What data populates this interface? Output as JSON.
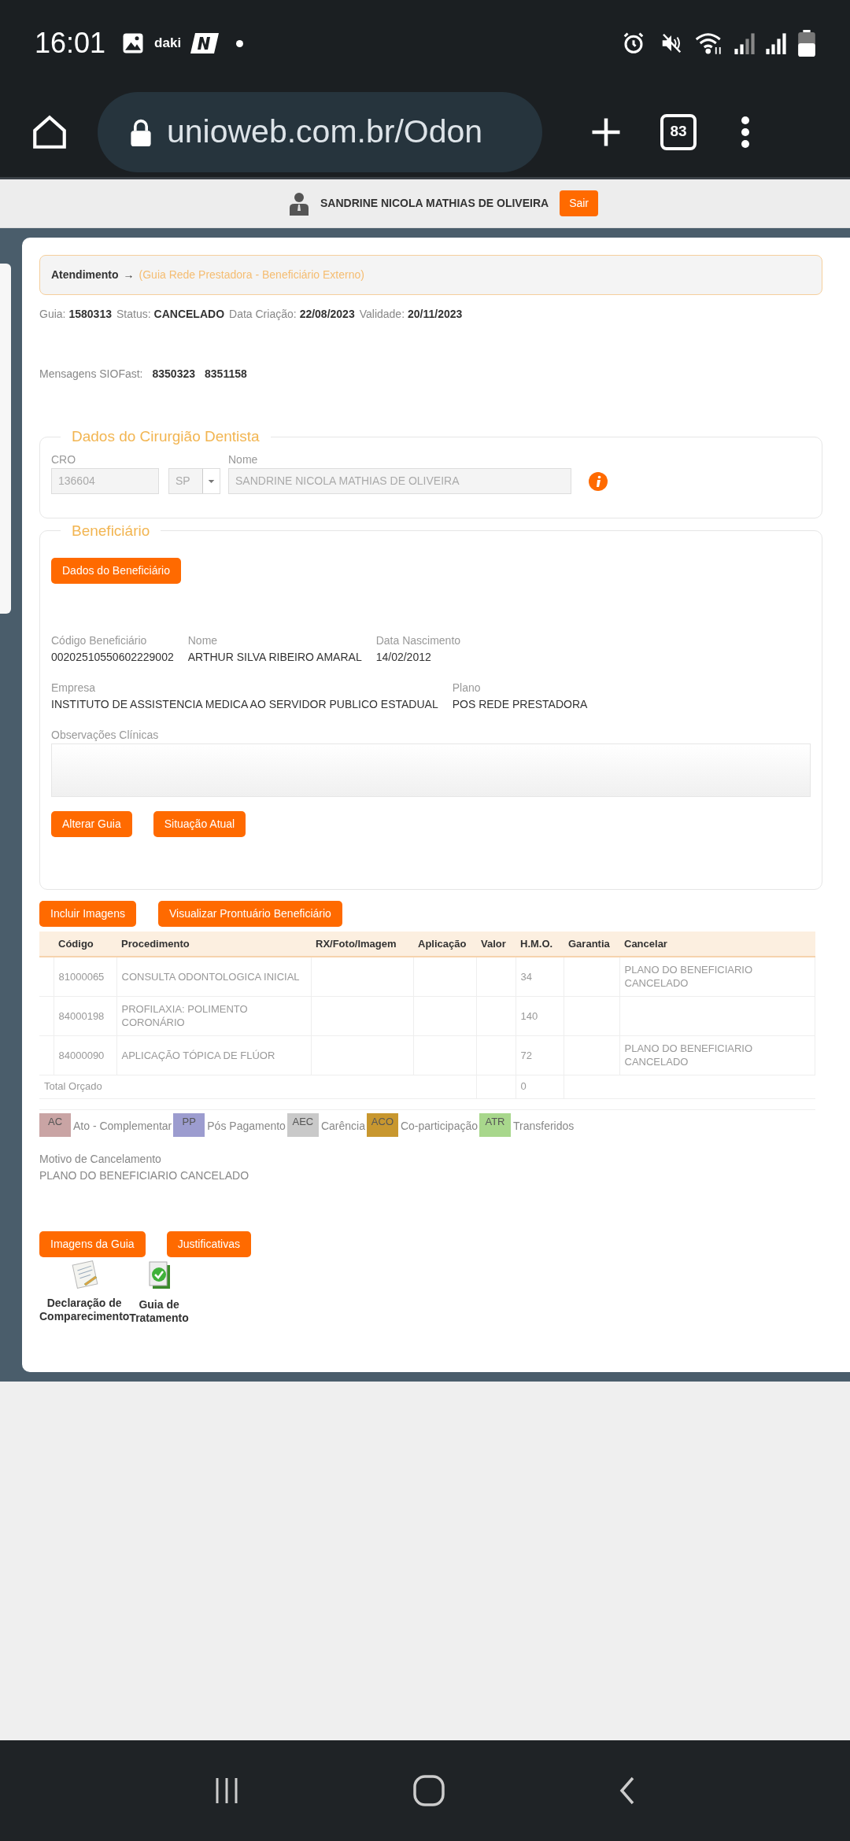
{
  "status_bar": {
    "time": "16:01",
    "app_label": "daki"
  },
  "browser": {
    "url": "unioweb.com.br/Odon",
    "tab_count": "83"
  },
  "header": {
    "user_name": "SANDRINE NICOLA MATHIAS DE OLIVEIRA",
    "logout_button": "Sair"
  },
  "breadcrumb": {
    "title": "Atendimento",
    "arrow": "→",
    "subtitle": "(Guia Rede Prestadora - Beneficiário Externo)"
  },
  "guide_info": [
    {
      "label": "Guia:",
      "value": "1580313"
    },
    {
      "label": "Status:",
      "value": "CANCELADO"
    },
    {
      "label": "Data Criação:",
      "value": "22/08/2023"
    },
    {
      "label": "Validade:",
      "value": "20/11/2023"
    }
  ],
  "messages": {
    "label": "Mensagens SIOFast:",
    "values": [
      "8350323",
      "8351158"
    ]
  },
  "dentist": {
    "legend": "Dados do Cirurgião Dentista",
    "disabled": true,
    "cro_label": "CRO",
    "cro": "136604",
    "uf": "SP",
    "name_label": "Nome",
    "name": "SANDRINE NICOLA MATHIAS DE OLIVEIRA"
  },
  "beneficiary": {
    "legend": "Beneficiário",
    "details_button": "Dados do Beneficiário",
    "fields_row1": [
      {
        "label": "Código Beneficiário",
        "value": "00202510550602229002"
      },
      {
        "label": "Nome",
        "value": "ARTHUR SILVA RIBEIRO AMARAL"
      },
      {
        "label": "Data Nascimento",
        "value": "14/02/2012"
      }
    ],
    "fields_row2": [
      {
        "label": "Empresa",
        "value": "INSTITUTO DE ASSISTENCIA MEDICA AO SERVIDOR PUBLICO ESTADUAL"
      },
      {
        "label": "Plano",
        "value": "POS REDE PRESTADORA"
      }
    ],
    "notes_label": "Observações Clínicas",
    "buttons": [
      "Alterar Guia",
      "Situação Atual"
    ]
  },
  "action_buttons": [
    "Incluir Imagens",
    "Visualizar Prontuário Beneficiário"
  ],
  "table": {
    "columns": [
      "Código",
      "Procedimento",
      "RX/Foto/Imagem",
      "Aplicação",
      "Valor",
      "H.M.O.",
      "Garantia",
      "Cancelar"
    ],
    "rows": [
      {
        "code": "81000065",
        "procedure": "CONSULTA ODONTOLOGICA INICIAL",
        "hmo": "34",
        "cancel": "PLANO DO BENEFICIARIO CANCELADO"
      },
      {
        "code": "84000198",
        "procedure": "PROFILAXIA: POLIMENTO CORONÁRIO",
        "hmo": "140"
      },
      {
        "code": "84000090",
        "procedure": "APLICAÇÃO TÓPICA DE FLÚOR",
        "hmo": "72",
        "cancel": "PLANO DO BENEFICIARIO CANCELADO"
      }
    ],
    "total_label": "Total Orçado",
    "total_hmo": "0"
  },
  "legend": [
    {
      "code": "AC",
      "label": "Ato - Complementar",
      "color": "#c9a4a4"
    },
    {
      "code": "PP",
      "label": "Pós Pagamento",
      "color": "#9c9ccf"
    },
    {
      "code": "AEC",
      "label": "Carência",
      "color": "#c9c9c9"
    },
    {
      "code": "ACO",
      "label": "Co-participação",
      "color": "#c8972f"
    },
    {
      "code": "ATR",
      "label": "Transferidos",
      "color": "#a8d78c"
    }
  ],
  "cancellation": {
    "label": "Motivo de Cancelamento",
    "value": "PLANO DO BENEFICIARIO CANCELADO"
  },
  "bottom_buttons": [
    "Imagens da Guia",
    "Justificativas"
  ],
  "documents": [
    {
      "kind": "declaration",
      "lines": [
        "Declaração de",
        "Comparecimento"
      ]
    },
    {
      "kind": "treatment",
      "lines": [
        "Guia de",
        "Tratamento"
      ]
    }
  ]
}
